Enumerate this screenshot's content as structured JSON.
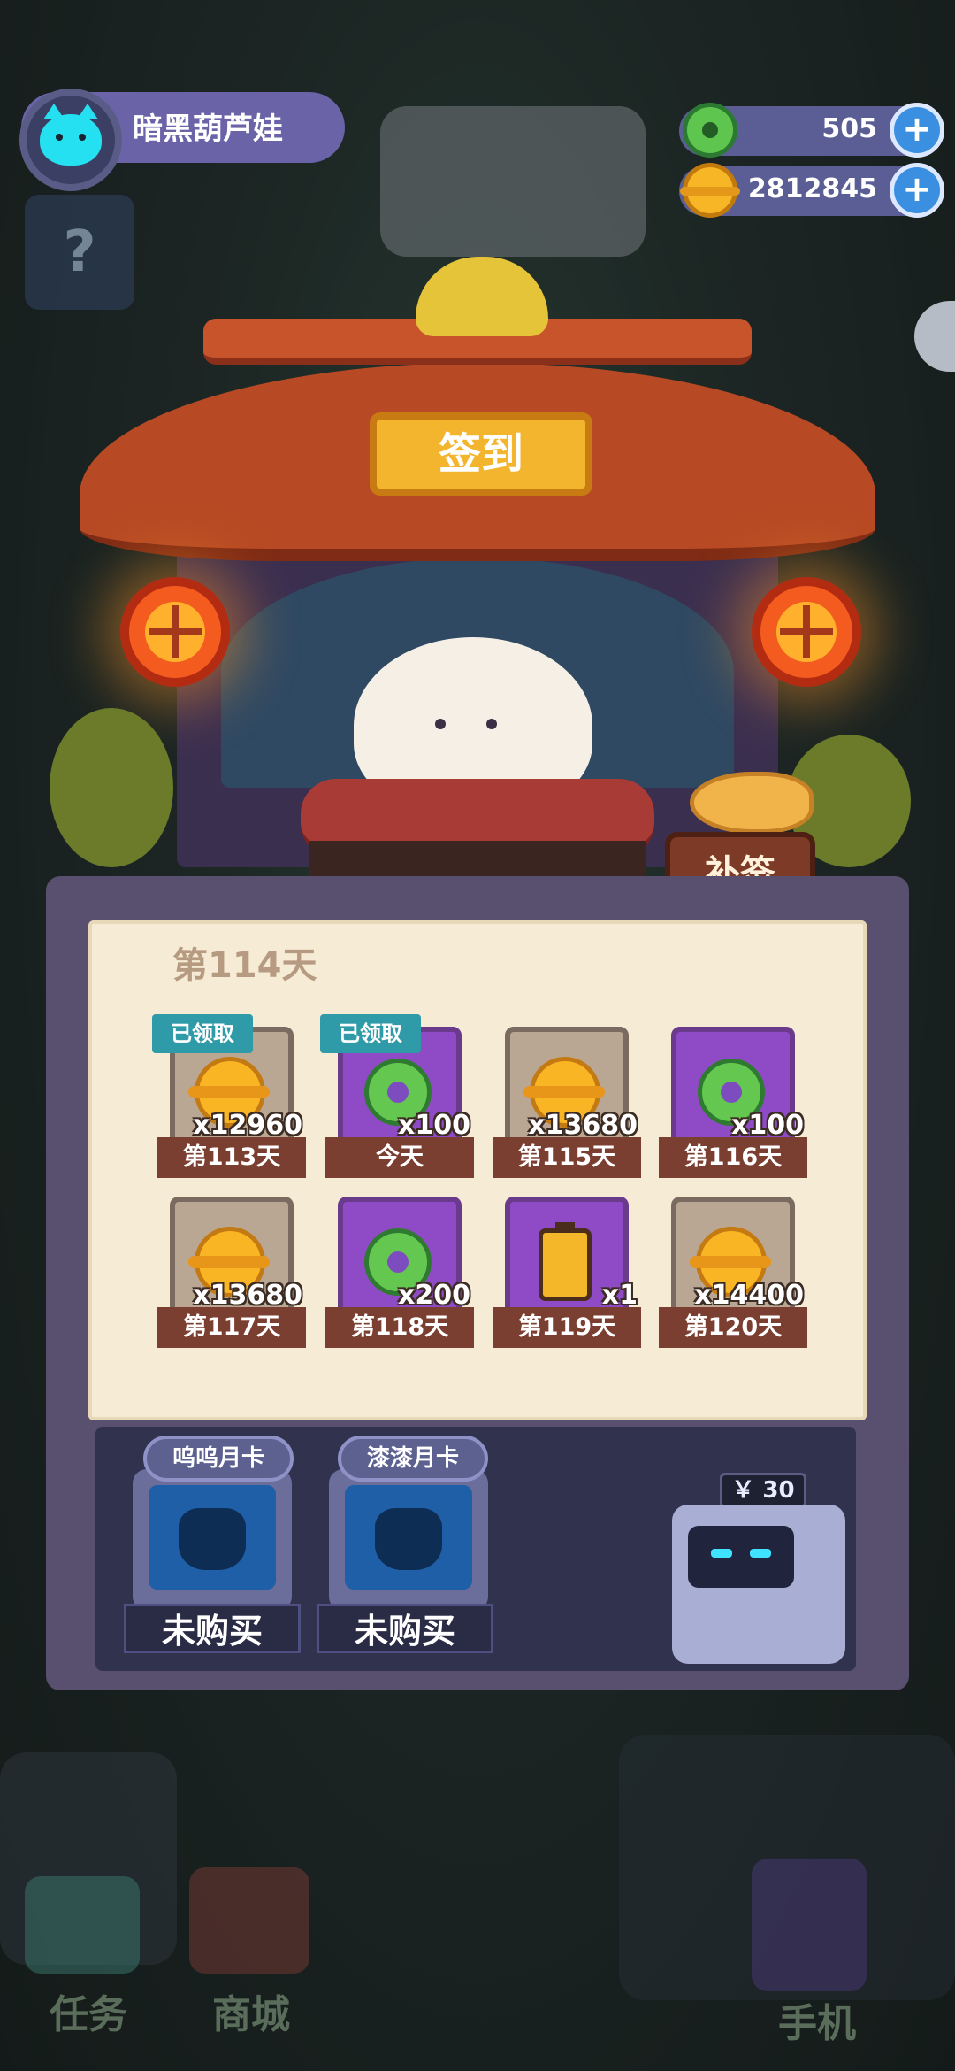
{
  "player": {
    "name": "暗黑葫芦娃"
  },
  "currencies": [
    {
      "icon": "jade-coin-icon",
      "value": "505"
    },
    {
      "icon": "gold-coin-icon",
      "value": "2812845"
    }
  ],
  "shrine": {
    "sign_label": "签到",
    "makeup_label": "补签"
  },
  "checkin": {
    "title": "第114天",
    "claimed_label": "已领取",
    "rewards": [
      {
        "type": "gold",
        "qty": "x12960",
        "label": "第113天",
        "claimed": true
      },
      {
        "type": "jade",
        "qty": "x100",
        "label": "今天",
        "claimed": true
      },
      {
        "type": "gold",
        "qty": "x13680",
        "label": "第115天",
        "claimed": false
      },
      {
        "type": "jade",
        "qty": "x100",
        "label": "第116天",
        "claimed": false
      },
      {
        "type": "gold",
        "qty": "x13680",
        "label": "第117天",
        "claimed": false
      },
      {
        "type": "jade",
        "qty": "x200",
        "label": "第118天",
        "claimed": false
      },
      {
        "type": "energy",
        "qty": "x1",
        "label": "第119天",
        "claimed": false
      },
      {
        "type": "gold",
        "qty": "x14400",
        "label": "第120天",
        "claimed": false
      }
    ]
  },
  "monthly_cards": [
    {
      "name": "呜呜月卡",
      "status": "未购买"
    },
    {
      "name": "漆漆月卡",
      "status": "未购买"
    }
  ],
  "vending": {
    "price": "￥ 30"
  },
  "bottom_nav": [
    {
      "label": "任务"
    },
    {
      "label": "商城"
    },
    {
      "label": "手机"
    }
  ],
  "colors": {
    "gold": "#f9b524",
    "jade": "#64c850",
    "label_bg": "#7b3f32",
    "claimed_tag": "#2f9aa8"
  }
}
